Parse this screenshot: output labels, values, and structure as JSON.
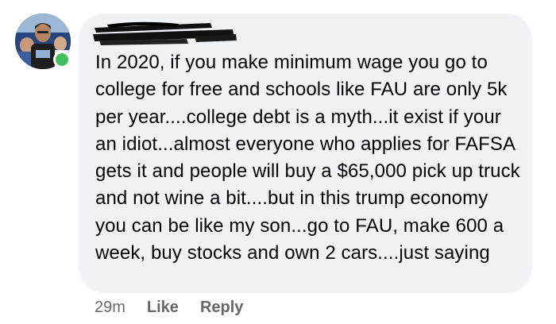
{
  "comment": {
    "author_name": "",
    "text": "In 2020, if you make minimum wage you go to college for free and schools like FAU are only 5k per year....college debt is a myth...it exist if your an idiot...almost everyone who applies for FAFSA gets it and people will buy a $65,000 pick up truck and not wine a bit....but in this trump economy you can be like my son...go to FAU, make 600 a week, buy stocks and own 2 cars....just saying",
    "timestamp": "29m",
    "like_label": "Like",
    "reply_label": "Reply"
  },
  "colors": {
    "bubble_bg": "#f0f2f5",
    "text": "#050505",
    "secondary_text": "#65676b",
    "online_indicator": "#45bd62"
  },
  "icons": {
    "avatar": "profile-photo",
    "presence": "online-dot"
  }
}
